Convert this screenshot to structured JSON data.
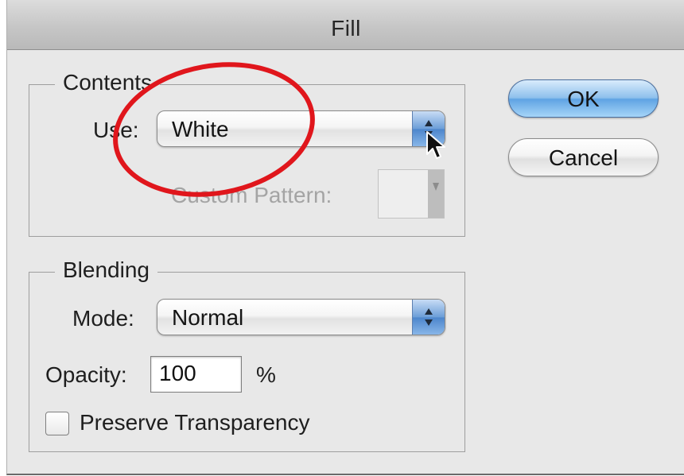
{
  "window": {
    "title": "Fill"
  },
  "contents": {
    "legend": "Contents",
    "use_label": "Use:",
    "use_value": "White",
    "custom_pattern_label": "Custom Pattern:"
  },
  "blending": {
    "legend": "Blending",
    "mode_label": "Mode:",
    "mode_value": "Normal",
    "opacity_label": "Opacity:",
    "opacity_value": "100",
    "opacity_unit": "%",
    "preserve_label": "Preserve Transparency",
    "preserve_checked": false
  },
  "buttons": {
    "ok": "OK",
    "cancel": "Cancel"
  },
  "icons": {
    "stepper": "up-down-arrows-icon",
    "pointer": "mouse-pointer-icon",
    "highlight": "red-circle-annotation"
  },
  "colors": {
    "annotation": "#e0161c",
    "default_button": "#7ab4ea",
    "stepper": "#5b91d4"
  }
}
